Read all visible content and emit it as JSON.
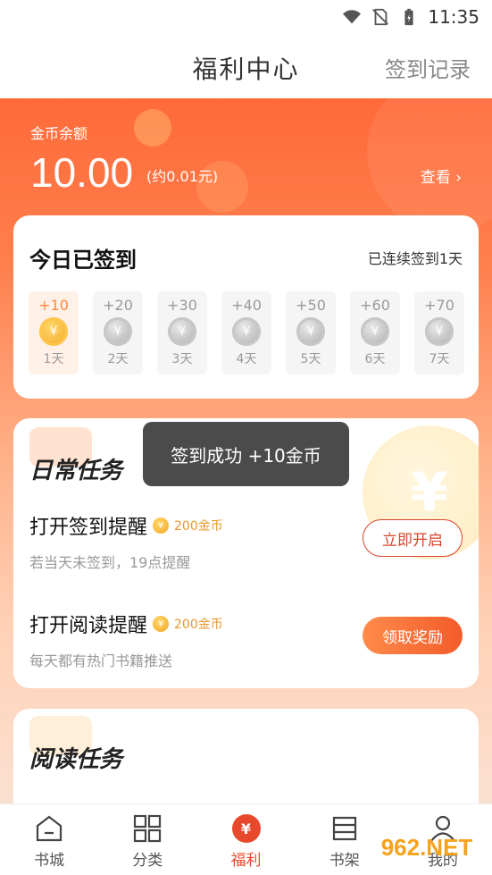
{
  "status_bar": {
    "time": "11:35",
    "icons": [
      "wifi-icon",
      "no-sim-icon",
      "battery-icon"
    ]
  },
  "header": {
    "title": "福利中心",
    "action": "签到记录"
  },
  "balance": {
    "label": "金币余额",
    "value": "10.00",
    "approx": "(约0.01元)",
    "view_link": "查看 ›"
  },
  "checkin": {
    "title": "今日已签到",
    "streak": "已连续签到1天",
    "days": [
      {
        "reward": "+10",
        "label": "1天",
        "active": true
      },
      {
        "reward": "+20",
        "label": "2天",
        "active": false
      },
      {
        "reward": "+30",
        "label": "3天",
        "active": false
      },
      {
        "reward": "+40",
        "label": "4天",
        "active": false
      },
      {
        "reward": "+50",
        "label": "5天",
        "active": false
      },
      {
        "reward": "+60",
        "label": "6天",
        "active": false
      },
      {
        "reward": "+70",
        "label": "7天",
        "active": false
      }
    ],
    "coin_symbol": "¥"
  },
  "daily_tasks": {
    "title": "日常任务",
    "tasks": [
      {
        "name": "打开签到提醒",
        "reward": "200金币",
        "desc": "若当天未签到，19点提醒",
        "button": "立即开启"
      },
      {
        "name": "打开阅读提醒",
        "reward": "200金币",
        "desc": "每天都有热门书籍推送",
        "button": "领取奖励"
      }
    ]
  },
  "toast": {
    "text": "签到成功 +10金币"
  },
  "reading_tasks": {
    "title": "阅读任务"
  },
  "bottom_nav": [
    {
      "label": "书城",
      "icon": "bookstore-icon"
    },
    {
      "label": "分类",
      "icon": "category-icon"
    },
    {
      "label": "福利",
      "icon": "welfare-icon",
      "active": true,
      "symbol": "¥"
    },
    {
      "label": "书架",
      "icon": "bookshelf-icon"
    },
    {
      "label": "我的",
      "icon": "profile-icon"
    }
  ],
  "watermark": "962.NET",
  "colors": {
    "accent": "#e8482b",
    "hero_top": "#ff6a3a",
    "coin_gold": "#f5a623"
  }
}
